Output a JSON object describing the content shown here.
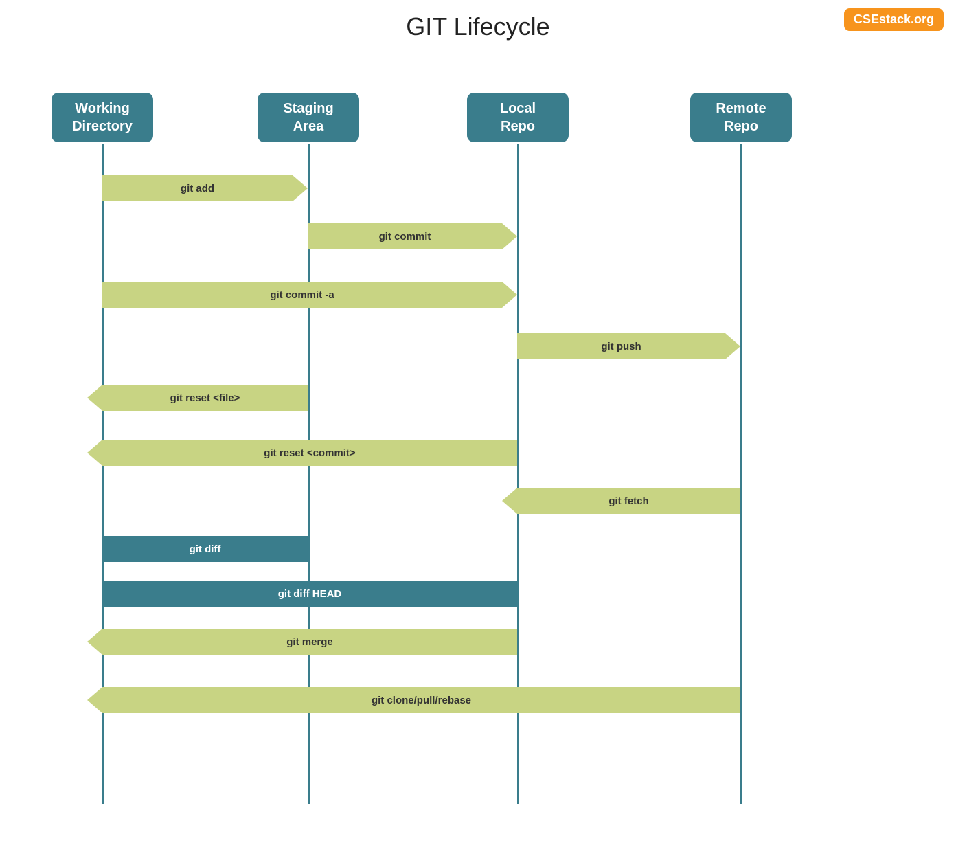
{
  "title": "GIT Lifecycle",
  "badge": "CSEstack.org",
  "columns": [
    {
      "id": "working",
      "label": "Working\nDirectory"
    },
    {
      "id": "staging",
      "label": "Staging\nArea"
    },
    {
      "id": "local",
      "label": "Local\nRepo"
    },
    {
      "id": "remote",
      "label": "Remote\nRepo"
    }
  ],
  "commands": [
    {
      "id": "git-add",
      "label": "git add",
      "direction": "right",
      "from": "working",
      "to": "staging"
    },
    {
      "id": "git-commit",
      "label": "git commit",
      "direction": "right",
      "from": "staging",
      "to": "local"
    },
    {
      "id": "git-commit-a",
      "label": "git commit -a",
      "direction": "right",
      "from": "working",
      "to": "local"
    },
    {
      "id": "git-push",
      "label": "git push",
      "direction": "right",
      "from": "local",
      "to": "remote"
    },
    {
      "id": "git-reset-file",
      "label": "git reset <file>",
      "direction": "left",
      "from": "staging",
      "to": "working"
    },
    {
      "id": "git-reset-commit",
      "label": "git reset <commit>",
      "direction": "left",
      "from": "local",
      "to": "working"
    },
    {
      "id": "git-fetch",
      "label": "git fetch",
      "direction": "left",
      "from": "remote",
      "to": "local"
    },
    {
      "id": "git-diff",
      "label": "git diff",
      "direction": "teal",
      "from": "working",
      "to": "staging"
    },
    {
      "id": "git-diff-head",
      "label": "git diff HEAD",
      "direction": "teal",
      "from": "working",
      "to": "local"
    },
    {
      "id": "git-merge",
      "label": "git merge",
      "direction": "left",
      "from": "local",
      "to": "working"
    },
    {
      "id": "git-clone",
      "label": "git clone/pull/rebase",
      "direction": "left",
      "from": "remote",
      "to": "working"
    }
  ]
}
